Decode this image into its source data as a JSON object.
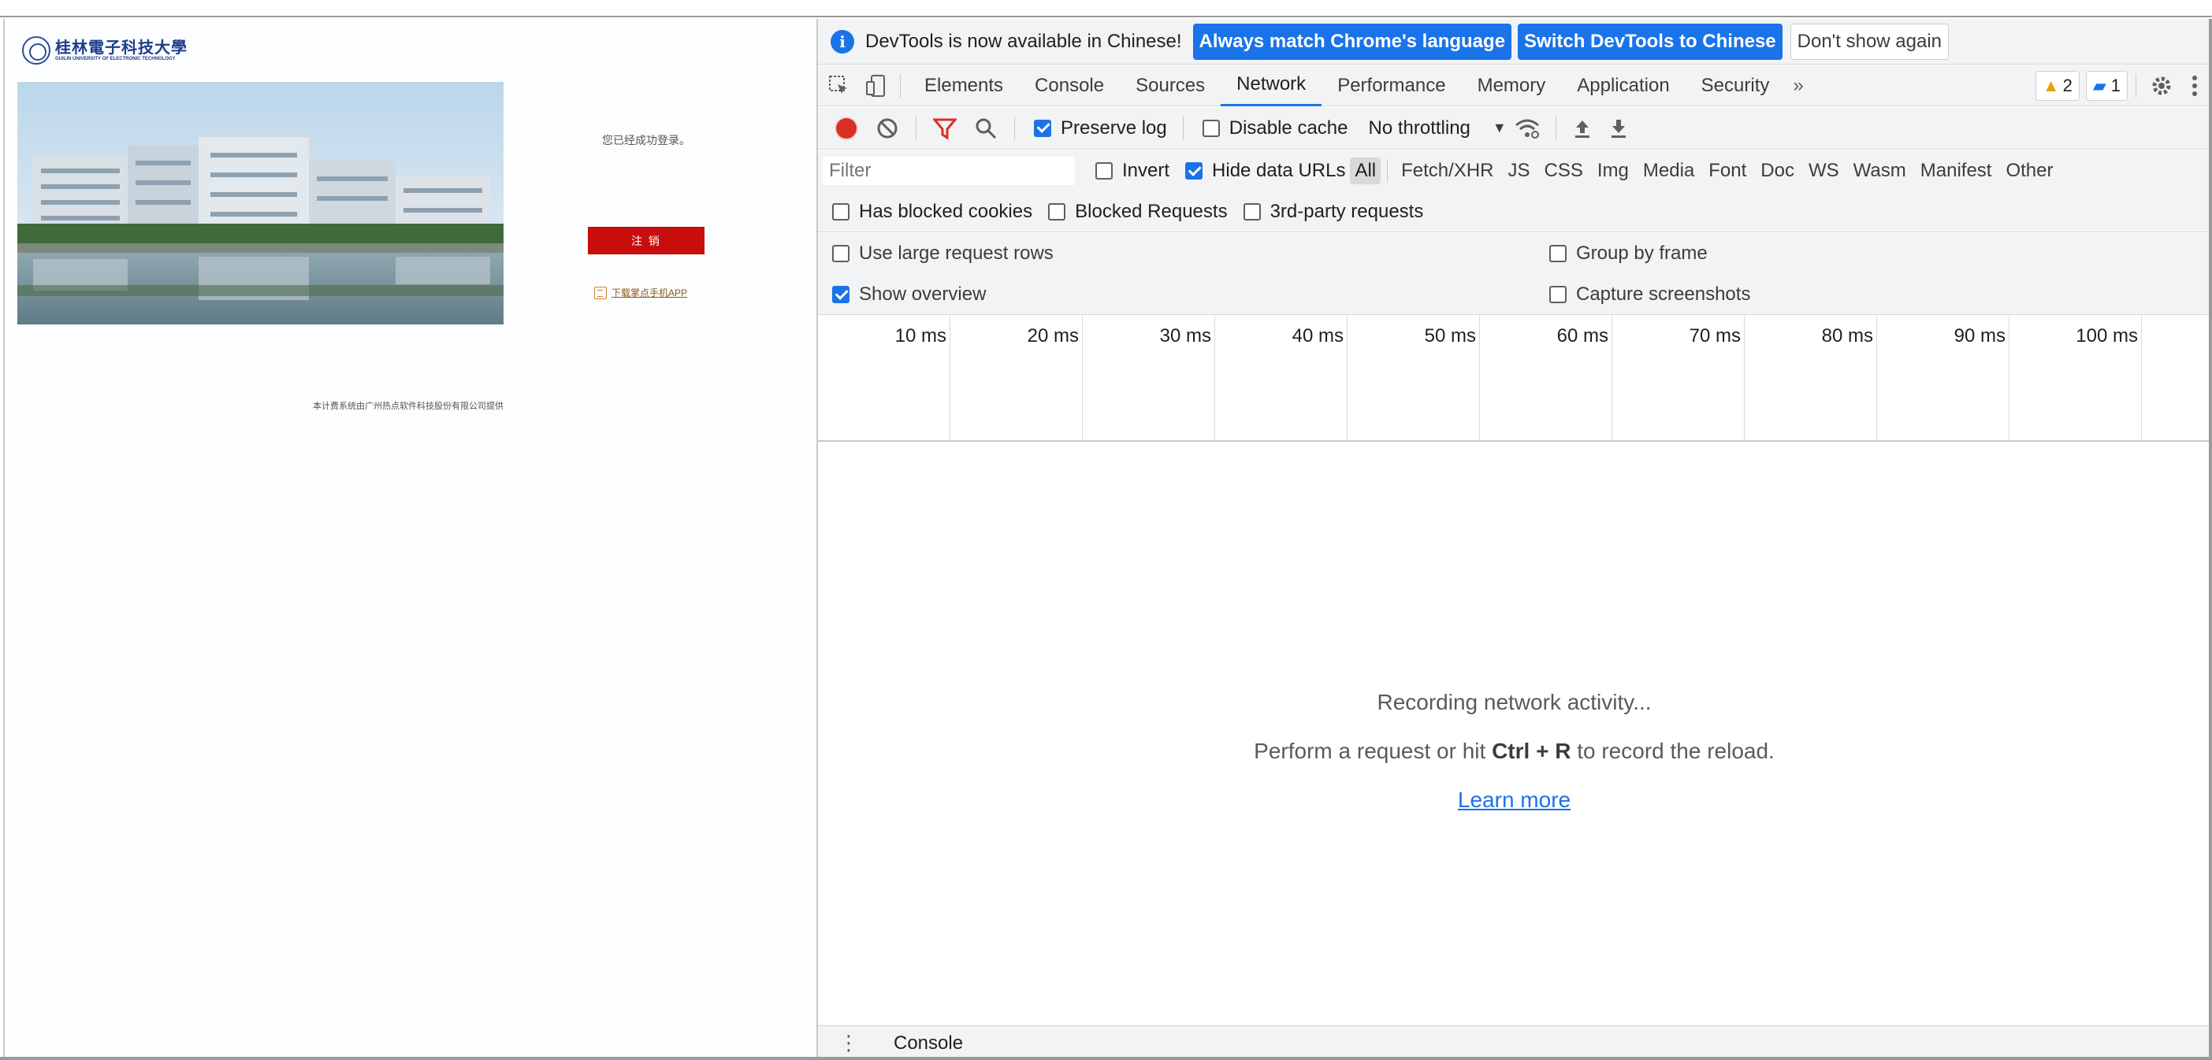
{
  "page": {
    "logo_cn": "桂林電子科技大學",
    "logo_en": "GUILIN UNIVERSITY OF ELECTRONIC TECHNOLOGY",
    "login_message": "您已经成功登录。",
    "logout_label": "注 销",
    "app_link": "下载掌点手机APP",
    "footer": "本计费系统由广州热点软件科技股份有限公司提供",
    "brand_color": "#c80d0d"
  },
  "devtools": {
    "infobar": {
      "message": "DevTools is now available in Chinese!",
      "btn_match": "Always match Chrome's language",
      "btn_switch": "Switch DevTools to Chinese",
      "btn_dismiss": "Don't show again"
    },
    "tabs": [
      {
        "label": "Elements"
      },
      {
        "label": "Console"
      },
      {
        "label": "Sources"
      },
      {
        "label": "Network",
        "active": true
      },
      {
        "label": "Performance"
      },
      {
        "label": "Memory"
      },
      {
        "label": "Application"
      },
      {
        "label": "Security"
      }
    ],
    "more_tabs": "»",
    "warnings_count": "2",
    "messages_count": "1",
    "toolbar": {
      "preserve_log": "Preserve log",
      "disable_cache": "Disable cache",
      "throttling": "No throttling",
      "preserve_log_checked": true,
      "disable_cache_checked": false
    },
    "filter": {
      "placeholder": "Filter",
      "invert": "Invert",
      "hide_data_urls": "Hide data URLs",
      "types": [
        "All",
        "Fetch/XHR",
        "JS",
        "CSS",
        "Img",
        "Media",
        "Font",
        "Doc",
        "WS",
        "Wasm",
        "Manifest",
        "Other"
      ]
    },
    "blocked": {
      "has_blocked_cookies": "Has blocked cookies",
      "blocked_requests": "Blocked Requests",
      "third_party": "3rd-party requests"
    },
    "settings": {
      "large_rows": "Use large request rows",
      "show_overview": "Show overview",
      "group_by_frame": "Group by frame",
      "capture_screenshots": "Capture screenshots"
    },
    "overview_ticks": [
      "10 ms",
      "20 ms",
      "30 ms",
      "40 ms",
      "50 ms",
      "60 ms",
      "70 ms",
      "80 ms",
      "90 ms",
      "100 ms"
    ],
    "empty": {
      "line1": "Recording network activity...",
      "line2_pre": "Perform a request or hit ",
      "line2_key": "Ctrl + R",
      "line2_post": " to record the reload.",
      "learn_more": "Learn more"
    },
    "drawer": {
      "label": "Console"
    },
    "accent": "#1a73e8"
  }
}
